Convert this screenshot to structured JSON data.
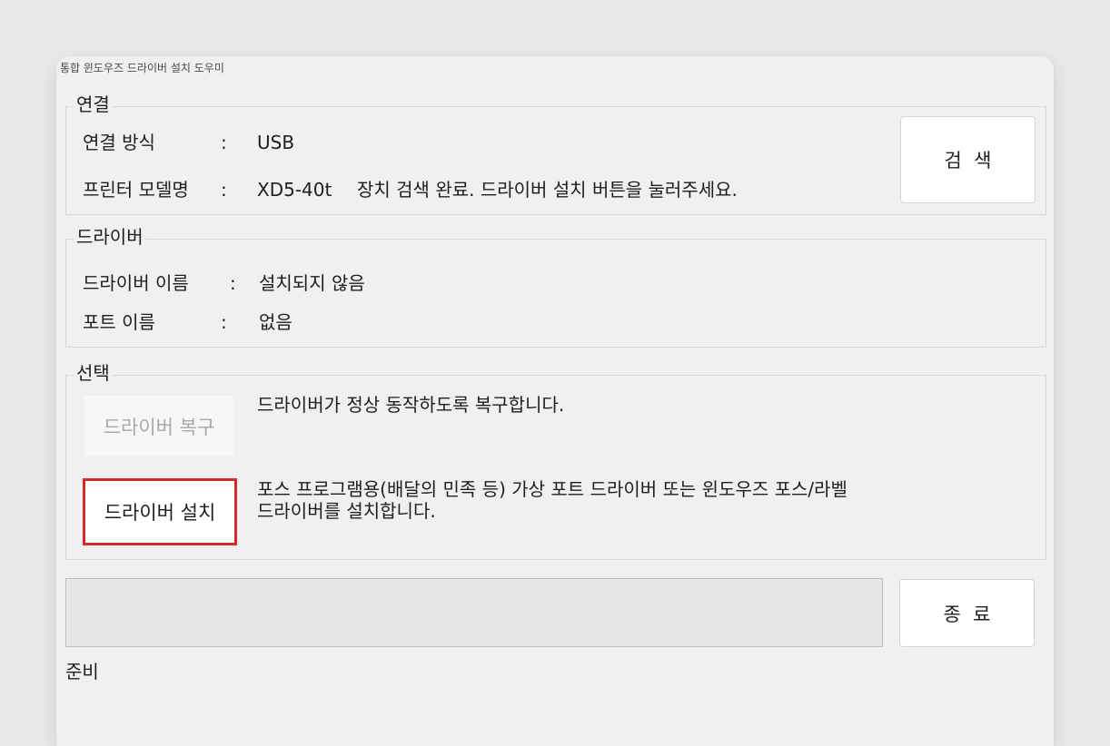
{
  "window": {
    "title": "통합 윈도우즈 드라이버 설치 도우미"
  },
  "connection": {
    "label": "연결",
    "method_label": "연결 방식",
    "colon1": ":",
    "method_value": "USB",
    "model_label": "프린터 모델명",
    "colon2": ":",
    "model_value": "XD5-40t",
    "status_message": "장치 검색 완료. 드라이버 설치 버튼을 눌러주세요.",
    "search_button": "검  색"
  },
  "driver": {
    "label": "드라이버",
    "name_label": "드라이버 이름",
    "colon1": ":",
    "name_value": "설치되지 않음",
    "port_label": "포트 이름",
    "colon2": ":",
    "port_value": "없음"
  },
  "select": {
    "label": "선택",
    "restore_button": "드라이버 복구",
    "restore_desc": "드라이버가 정상 동작하도록 복구합니다.",
    "install_button": "드라이버 설치",
    "install_desc_line1": "포스 프로그램용(배달의 민족 등) 가상 포트 드라이버 또는 윈도우즈 포스/라벨",
    "install_desc_line2": "드라이버를 설치합니다."
  },
  "footer": {
    "exit_button": "종  료",
    "status": "준비",
    "progress": 0
  }
}
